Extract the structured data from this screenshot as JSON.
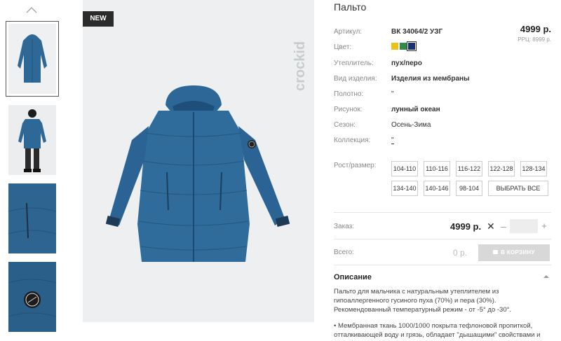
{
  "gallery": {
    "badge": "NEW",
    "thumbnails": [
      {
        "alt": "jacket-front"
      },
      {
        "alt": "child-model"
      },
      {
        "alt": "pocket-detail"
      },
      {
        "alt": "badge-detail"
      }
    ]
  },
  "product": {
    "title": "Пальто",
    "price": "4999 р.",
    "rrp": "РРЦ: 8999 р.",
    "attributes": {
      "article_label": "Артикул:",
      "article_value": "ВК 34064/2 УЗГ",
      "color_label": "Цвет:",
      "colors": [
        "#e9c21a",
        "#2f8c4a",
        "#1c2f6e"
      ],
      "insulation_label": "Утеплитель:",
      "insulation_value": "пух/перо",
      "type_label": "Вид изделия:",
      "type_value": "Изделия из мембраны",
      "fabric_label": "Полотно:",
      "fabric_value": "\"",
      "pattern_label": "Рисунок:",
      "pattern_value": "лунный океан",
      "season_label": "Сезон:",
      "season_value": "Осень-Зима",
      "collection_label": "Коллекция:",
      "collection_value": "\"",
      "size_label": "Рост/размер:"
    },
    "sizes": [
      "104-110",
      "110-116",
      "116-122",
      "122-128",
      "128-134",
      "134-140",
      "140-146",
      "98-104"
    ],
    "select_all": "ВЫБРАТЬ ВСЕ"
  },
  "order": {
    "label": "Заказ:",
    "price": "4999 р.",
    "times": "✕",
    "minus": "–",
    "plus": "+",
    "qty": ""
  },
  "total": {
    "label": "Всего:",
    "value": "0 р.",
    "cart_button": "В КОРЗИНУ"
  },
  "description": {
    "title": "Описание",
    "p1": "Пальто для мальчика с натуральным утеплителем из гипоаллергенного гусиного пуха (70%) и пера (30%). Рекомендованный температурный режим - от -5° до -30°.",
    "p2": "• Мембранная ткань 1000/1000 покрыта тефлоновой пропиткой, отталкивающей воду и грязь, обладает \"дышащими\" свойствами и"
  },
  "brand": "crockid"
}
